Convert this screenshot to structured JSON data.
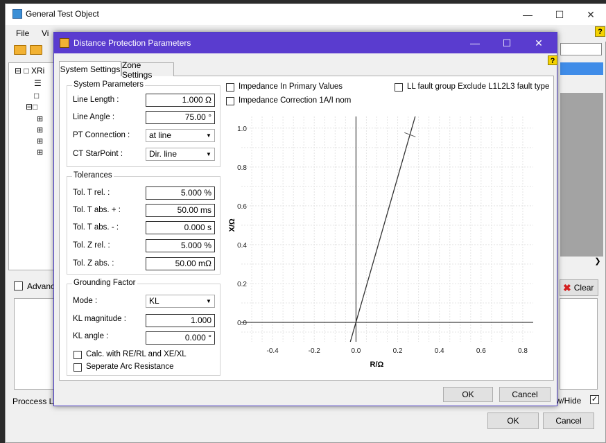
{
  "main_window": {
    "title": "General Test Object",
    "menu": {
      "file": "File",
      "view": "Vi"
    },
    "help_glyph": "?",
    "tree": {
      "root_label": "XRi"
    },
    "advanced_label": "Advanc",
    "process_log_label": "Proccess Lo",
    "clear_label": "Clear",
    "show_hide_label": "ow/Hide",
    "ok_label": "OK",
    "cancel_label": "Cancel"
  },
  "dialog": {
    "title": "Distance Protection Parameters",
    "help_glyph": "?",
    "tabs": {
      "system": "System Settings",
      "zone": "Zone Settings"
    },
    "system_parameters": {
      "title": "System Parameters",
      "line_length_label": "Line Length :",
      "line_length_value": "1.000 Ω",
      "line_angle_label": "Line Angle :",
      "line_angle_value": "75.00 °",
      "pt_connection_label": "PT Connection :",
      "pt_connection_value": "at line",
      "ct_starpoint_label": "CT StarPoint :",
      "ct_starpoint_value": "Dir. line"
    },
    "tolerances": {
      "title": "Tolerances",
      "t_rel_label": "Tol. T rel. :",
      "t_rel_value": "5.000 %",
      "t_abs_plus_label": "Tol. T abs. + :",
      "t_abs_plus_value": "50.00 ms",
      "t_abs_minus_label": "Tol. T abs. - :",
      "t_abs_minus_value": "0.000 s",
      "z_rel_label": "Tol. Z rel. :",
      "z_rel_value": "5.000 %",
      "z_abs_label": "Tol. Z abs. :",
      "z_abs_value": "50.00 mΩ"
    },
    "grounding": {
      "title": "Grounding Factor",
      "mode_label": "Mode :",
      "mode_value": "KL",
      "kl_magnitude_label": "KL magnitude :",
      "kl_magnitude_value": "1.000",
      "kl_angle_label": "KL angle :",
      "kl_angle_value": "0.000 °",
      "calc_label": "Calc. with RE/RL and XE/XL",
      "arc_label": "Seperate Arc Resistance"
    },
    "impedance_primary_label": "Impedance In Primary Values",
    "impedance_correction_label": "Impedance Correction 1A/I nom",
    "ll_fault_label": "LL fault group Exclude L1L2L3 fault type",
    "ok_label": "OK",
    "cancel_label": "Cancel"
  },
  "chart_data": {
    "type": "line",
    "xlabel": "R/Ω",
    "ylabel": "X/Ω",
    "xlim": [
      -0.55,
      0.85
    ],
    "ylim": [
      -0.1,
      1.06
    ],
    "xticks": [
      "-0.4",
      "-0.2",
      "0.0",
      "0.2",
      "0.4",
      "0.6",
      "0.8"
    ],
    "xtick_values": [
      -0.4,
      -0.2,
      0.0,
      0.2,
      0.4,
      0.6,
      0.8
    ],
    "yticks": [
      "0.0",
      "0.2",
      "0.4",
      "0.6",
      "0.8",
      "1.0"
    ],
    "ytick_values": [
      0.0,
      0.2,
      0.4,
      0.6,
      0.8,
      1.0
    ],
    "grid": true,
    "series": [
      {
        "x": [
          -0.027,
          0.284
        ],
        "y": [
          -0.1,
          1.06
        ]
      }
    ],
    "marker": {
      "x": 0.259,
      "y": 0.966
    }
  }
}
